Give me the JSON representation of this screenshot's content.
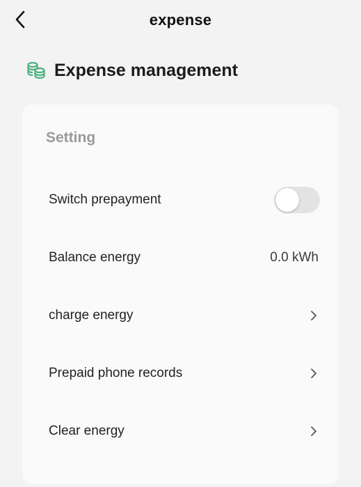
{
  "navbar": {
    "title": "expense",
    "back_icon": "chevron-left-icon"
  },
  "section": {
    "title": "Expense management",
    "icon": "coins-stack-icon",
    "icon_color": "#4caf7d"
  },
  "card": {
    "heading": "Setting",
    "rows": [
      {
        "label": "Switch prepayment",
        "control": "toggle",
        "toggle_on": false
      },
      {
        "label": "Balance energy",
        "value": "0.0 kWh"
      },
      {
        "label": "charge energy",
        "control": "chevron-right-icon"
      },
      {
        "label": "Prepaid phone records",
        "control": "chevron-right-icon"
      },
      {
        "label": "Clear energy",
        "control": "chevron-right-icon"
      }
    ]
  }
}
